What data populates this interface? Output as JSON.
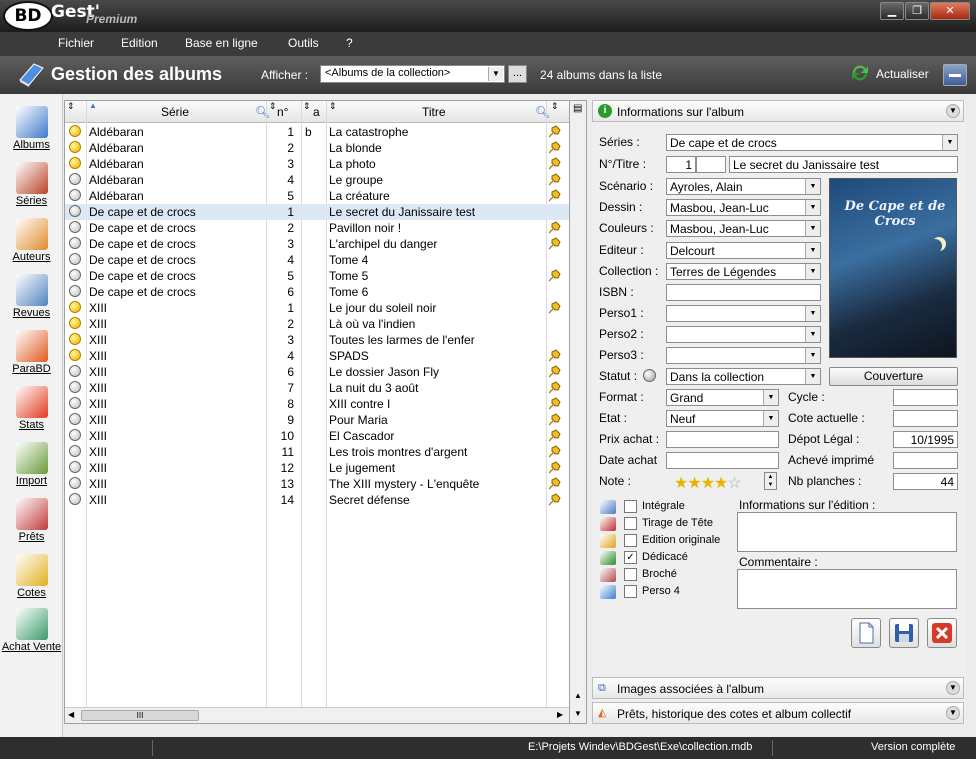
{
  "app": {
    "logo": "BD",
    "name": "Gest'",
    "edition": "Premium"
  },
  "window_buttons": {
    "minimize": "▁",
    "restore": "❐",
    "close": "✕"
  },
  "menu": [
    "Fichier",
    "Edition",
    "Base en ligne",
    "Outils",
    "?"
  ],
  "toolbar": {
    "title": "Gestion des albums",
    "show_label": "Afficher :",
    "filter": "<Albums de la collection>",
    "dots": "...",
    "count": "24 albums dans la liste",
    "refresh": "Actualiser"
  },
  "sidebar": [
    {
      "label": "Albums",
      "icon": "book-icon",
      "color": "#3d79c9"
    },
    {
      "label": "Séries",
      "icon": "books-stack-icon",
      "color": "#b8432a"
    },
    {
      "label": "Auteurs",
      "icon": "people-icon",
      "color": "#e08c2a"
    },
    {
      "label": "Revues",
      "icon": "newspaper-icon",
      "color": "#4f82c0"
    },
    {
      "label": "ParaBD",
      "icon": "palette-icon",
      "color": "#e05a1f"
    },
    {
      "label": "Stats",
      "icon": "pie-chart-icon",
      "color": "#e23a1f"
    },
    {
      "label": "Import",
      "icon": "clipboard-icon",
      "color": "#6a9a3a"
    },
    {
      "label": "Prêts",
      "icon": "calendar-people-icon",
      "color": "#c03a3a"
    },
    {
      "label": "Cotes",
      "icon": "coins-icon",
      "color": "#e0b020"
    },
    {
      "label": "Achat Vente",
      "icon": "cart-icon",
      "color": "#3a9a6a"
    }
  ],
  "grid": {
    "headers": {
      "serie": "Série",
      "num": "n°",
      "a": "a",
      "titre": "Titre"
    },
    "scroll_thumb": "III",
    "rows": [
      {
        "ball": "y",
        "serie": "Aldébaran",
        "num": "1",
        "a": "b",
        "titre": "La catastrophe",
        "pin": true
      },
      {
        "ball": "y",
        "serie": "Aldébaran",
        "num": "2",
        "a": "",
        "titre": "La blonde",
        "pin": true
      },
      {
        "ball": "y",
        "serie": "Aldébaran",
        "num": "3",
        "a": "",
        "titre": "La photo",
        "pin": true
      },
      {
        "ball": "g",
        "serie": "Aldébaran",
        "num": "4",
        "a": "",
        "titre": "Le groupe",
        "pin": true
      },
      {
        "ball": "g",
        "serie": "Aldébaran",
        "num": "5",
        "a": "",
        "titre": "La créature",
        "pin": true
      },
      {
        "ball": "g",
        "serie": "De cape et de crocs",
        "num": "1",
        "a": "",
        "titre": "Le secret du Janissaire test",
        "pin": false,
        "sel": true
      },
      {
        "ball": "g",
        "serie": "De cape et de crocs",
        "num": "2",
        "a": "",
        "titre": "Pavillon noir !",
        "pin": true
      },
      {
        "ball": "g",
        "serie": "De cape et de crocs",
        "num": "3",
        "a": "",
        "titre": "L'archipel du danger",
        "pin": true
      },
      {
        "ball": "g",
        "serie": "De cape et de crocs",
        "num": "4",
        "a": "",
        "titre": "Tome 4",
        "pin": false
      },
      {
        "ball": "g",
        "serie": "De cape et de crocs",
        "num": "5",
        "a": "",
        "titre": "Tome 5",
        "pin": true
      },
      {
        "ball": "g",
        "serie": "De cape et de crocs",
        "num": "6",
        "a": "",
        "titre": "Tome 6",
        "pin": false
      },
      {
        "ball": "y",
        "serie": "XIII",
        "num": "1",
        "a": "",
        "titre": "Le jour du soleil noir",
        "pin": true
      },
      {
        "ball": "y",
        "serie": "XIII",
        "num": "2",
        "a": "",
        "titre": "Là où va l'indien",
        "pin": false
      },
      {
        "ball": "y",
        "serie": "XIII",
        "num": "3",
        "a": "",
        "titre": "Toutes les larmes de l'enfer",
        "pin": false
      },
      {
        "ball": "y",
        "serie": "XIII",
        "num": "4",
        "a": "",
        "titre": "SPADS",
        "pin": true
      },
      {
        "ball": "g",
        "serie": "XIII",
        "num": "6",
        "a": "",
        "titre": "Le dossier Jason Fly",
        "pin": true
      },
      {
        "ball": "g",
        "serie": "XIII",
        "num": "7",
        "a": "",
        "titre": "La nuit du 3 août",
        "pin": true
      },
      {
        "ball": "g",
        "serie": "XIII",
        "num": "8",
        "a": "",
        "titre": "XIII contre I",
        "pin": true
      },
      {
        "ball": "g",
        "serie": "XIII",
        "num": "9",
        "a": "",
        "titre": "Pour Maria",
        "pin": true
      },
      {
        "ball": "g",
        "serie": "XIII",
        "num": "10",
        "a": "",
        "titre": "El Cascador",
        "pin": true
      },
      {
        "ball": "g",
        "serie": "XIII",
        "num": "11",
        "a": "",
        "titre": "Les trois montres d'argent",
        "pin": true
      },
      {
        "ball": "g",
        "serie": "XIII",
        "num": "12",
        "a": "",
        "titre": "Le jugement",
        "pin": true
      },
      {
        "ball": "g",
        "serie": "XIII",
        "num": "13",
        "a": "",
        "titre": "The XIII mystery - L'enquête",
        "pin": true
      },
      {
        "ball": "g",
        "serie": "XIII",
        "num": "14",
        "a": "",
        "titre": "Secret défense",
        "pin": true
      }
    ]
  },
  "info": {
    "header": "Informations sur l'album",
    "labels": {
      "series": "Séries :",
      "numtitre": "N°/Titre :",
      "scenario": "Scénario :",
      "dessin": "Dessin :",
      "couleurs": "Couleurs :",
      "editeur": "Editeur :",
      "collection": "Collection :",
      "isbn": "ISBN :",
      "perso1": "Perso1 :",
      "perso2": "Perso2 :",
      "perso3": "Perso3 :",
      "statut": "Statut :",
      "format": "Format :",
      "etat": "Etat :",
      "prix": "Prix achat :",
      "date": "Date achat",
      "note": "Note :",
      "cycle": "Cycle :",
      "cote": "Cote actuelle :",
      "depot": "Dépot Légal :",
      "acheve": "Achevé imprimé",
      "planches": "Nb planches :"
    },
    "values": {
      "series": "De cape et de crocs",
      "num": "1",
      "titre": "Le secret du Janissaire test",
      "scenario": "Ayroles, Alain",
      "dessin": "Masbou, Jean-Luc",
      "couleurs": "Masbou, Jean-Luc",
      "editeur": "Delcourt",
      "collection": "Terres de Légendes",
      "statut": "Dans la collection",
      "format": "Grand",
      "etat": "Neuf",
      "depot": "10/1995",
      "planches": "44",
      "note_stars": "★★★★",
      "note_empty": "☆",
      "note": 4
    },
    "cover_title": "De Cape et de Crocs",
    "cover_button": "Couverture",
    "checkboxes": [
      {
        "label": "Intégrale",
        "checked": false,
        "icon": "layers-icon"
      },
      {
        "label": "Tirage de Tête",
        "checked": false,
        "icon": "red-book-icon"
      },
      {
        "label": "Edition originale",
        "checked": false,
        "icon": "pin-icon"
      },
      {
        "label": "Dédicacé",
        "checked": true,
        "icon": "pen-icon"
      },
      {
        "label": "Broché",
        "checked": false,
        "icon": "open-book-icon"
      },
      {
        "label": "Perso 4",
        "checked": false,
        "icon": "star-icon"
      }
    ],
    "edition_info": "Informations sur l'édition :",
    "comment": "Commentaire :"
  },
  "sections": {
    "images": "Images associées à l'album",
    "prets": "Prêts, historique des cotes et album collectif"
  },
  "status": {
    "path": "E:\\Projets Windev\\BDGest\\Exe\\collection.mdb",
    "version": "Version complète"
  }
}
